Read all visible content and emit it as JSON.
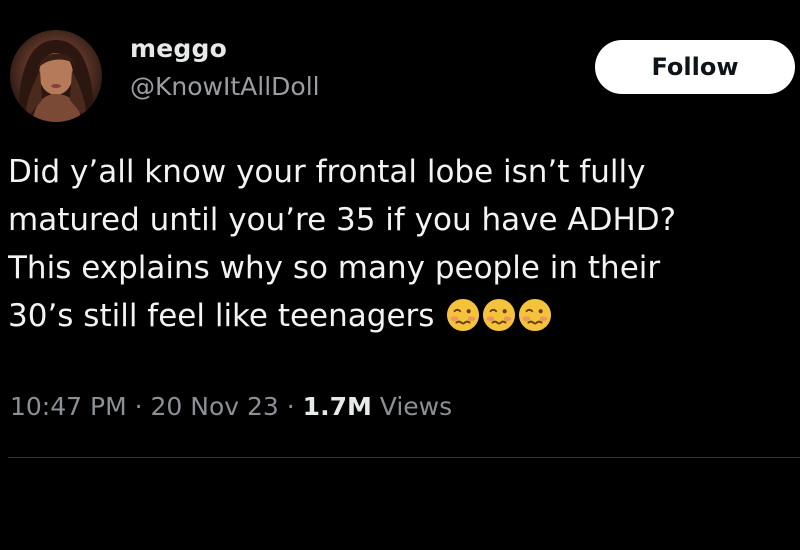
{
  "user": {
    "display_name": "meggo",
    "handle": "@KnowItAllDoll",
    "avatar_icon": "profile-photo"
  },
  "follow_label": "Follow",
  "tweet": {
    "line1": "Did y’all know your frontal lobe isn’t fully",
    "line2": "matured until you’re 35 if you have ADHD?",
    "line3": "This explains why so many people in their",
    "line4": "30’s still feel like teenagers",
    "emoji_icon": "woozy-face-emoji",
    "emoji_count": 3
  },
  "meta": {
    "time": "10:47 PM",
    "date": "20 Nov 23",
    "views_count": "1.7M",
    "views_label": "Views",
    "separator": "·"
  },
  "colors": {
    "background": "#000000",
    "text": "#e7e9ea",
    "muted": "#8b9096",
    "button_bg": "#ffffff",
    "button_text": "#0f1419"
  }
}
